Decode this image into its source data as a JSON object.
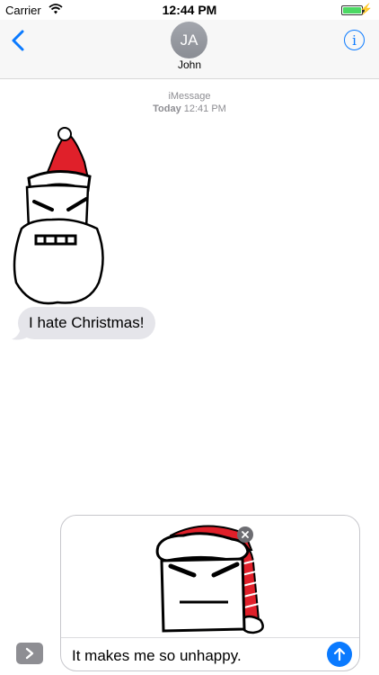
{
  "status_bar": {
    "carrier": "Carrier",
    "time": "12:44 PM",
    "icons": [
      "wifi-icon",
      "battery-icon",
      "charging-bolt-icon"
    ]
  },
  "header": {
    "back_icon": "chevron-left-icon",
    "contact_initials": "JA",
    "contact_name": "John",
    "info_icon_glyph": "i"
  },
  "conversation": {
    "service": "iMessage",
    "timestamp_day": "Today",
    "timestamp_time": "12:41 PM",
    "messages": [
      {
        "type": "sticker",
        "sticker": "santa-beard-sticker",
        "direction": "incoming"
      },
      {
        "type": "text",
        "text": "I hate Christmas!",
        "direction": "incoming"
      }
    ]
  },
  "compose": {
    "attached_sticker": "grumpy-santa-hat-sticker",
    "text": "It makes me so unhappy.",
    "send_icon": "arrow-up-icon",
    "apps_icon": "chevron-right-icon"
  },
  "colors": {
    "accent": "#0a7aff",
    "incoming_bubble": "#e5e5ea",
    "battery": "#4cd964",
    "sticker_red": "#e0202a"
  }
}
